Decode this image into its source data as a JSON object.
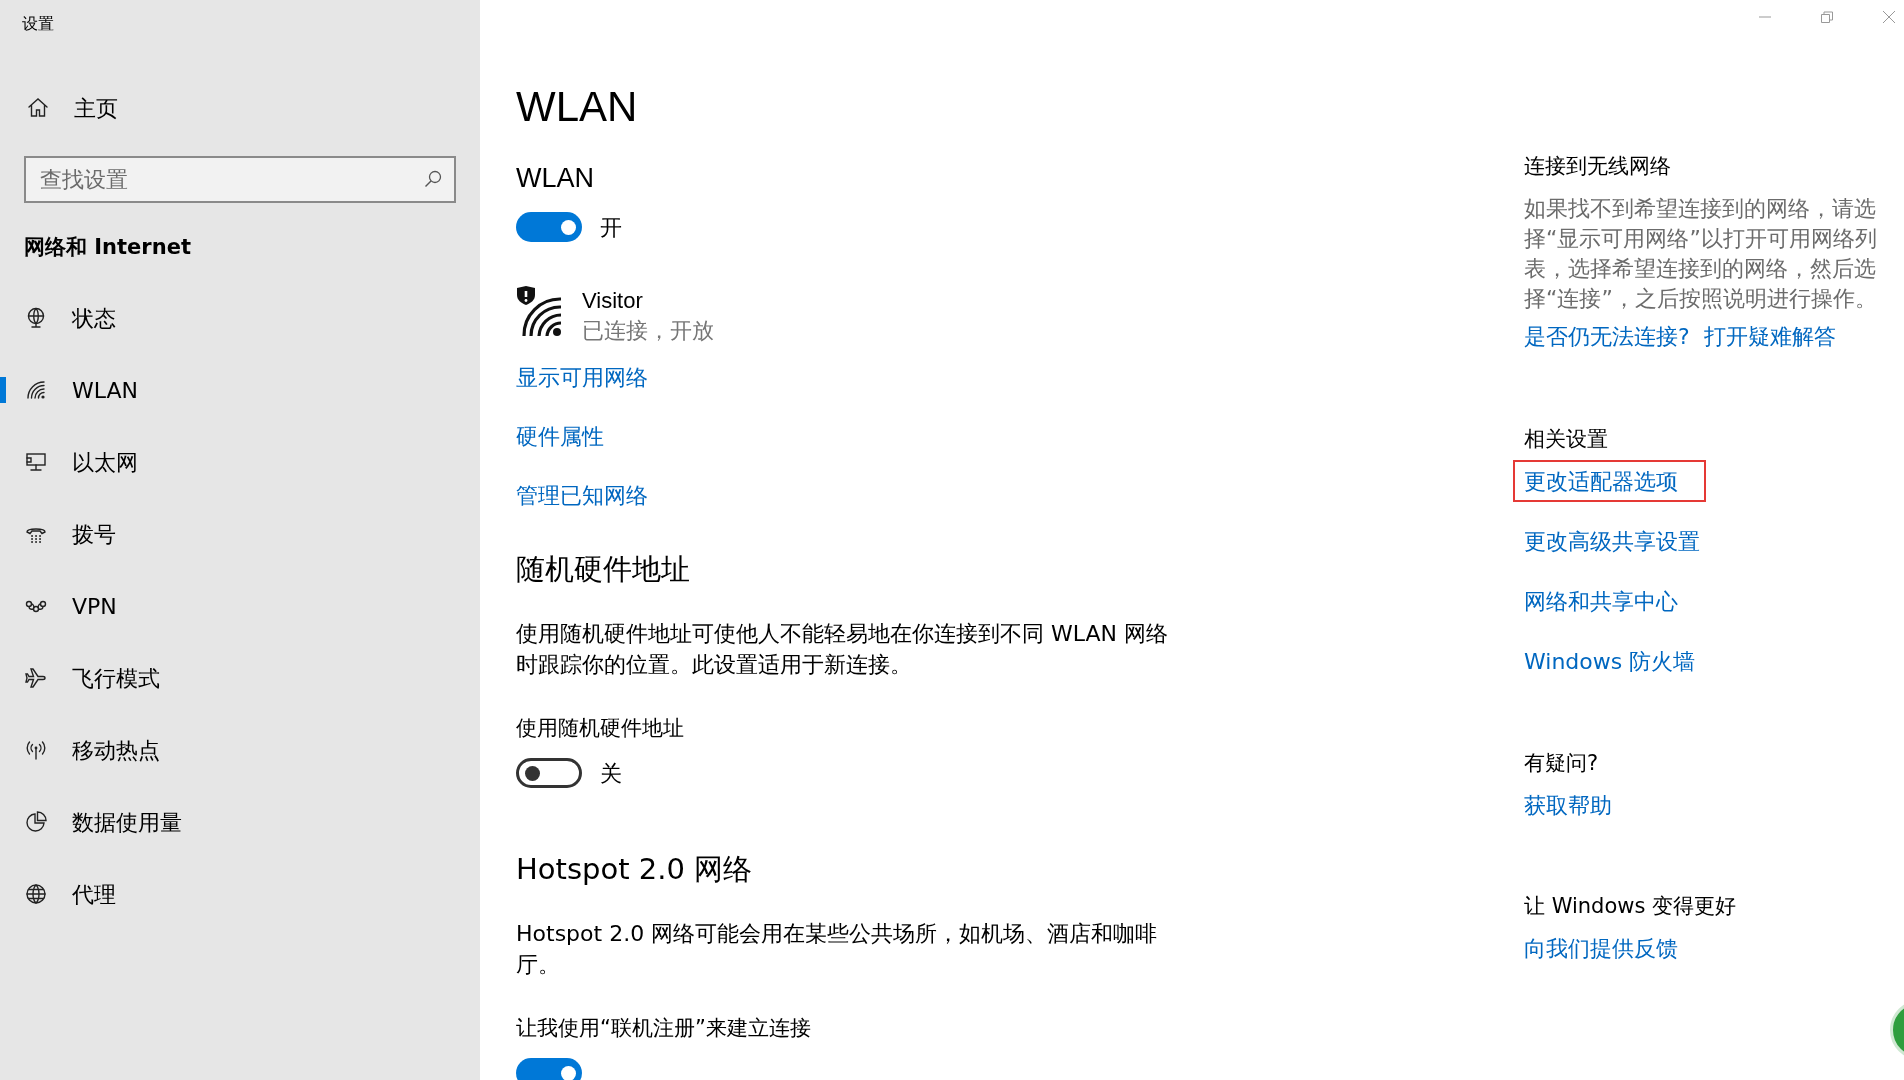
{
  "window": {
    "title": "设置"
  },
  "sidebar": {
    "home": "主页",
    "search": {
      "placeholder": "查找设置"
    },
    "section": "网络和 Internet",
    "items": [
      {
        "kind": "status",
        "label": "状态",
        "selected": false
      },
      {
        "kind": "wlan",
        "label": "WLAN",
        "selected": true
      },
      {
        "kind": "ethernet",
        "label": "以太网",
        "selected": false
      },
      {
        "kind": "dialup",
        "label": "拨号",
        "selected": false
      },
      {
        "kind": "vpn",
        "label": "VPN",
        "selected": false
      },
      {
        "kind": "airplane",
        "label": "飞行模式",
        "selected": false
      },
      {
        "kind": "hotspot",
        "label": "移动热点",
        "selected": false
      },
      {
        "kind": "data",
        "label": "数据使用量",
        "selected": false
      },
      {
        "kind": "proxy",
        "label": "代理",
        "selected": false
      }
    ]
  },
  "main": {
    "title": "WLAN",
    "wlan": {
      "label": "WLAN",
      "on": true,
      "state": "开"
    },
    "network": {
      "name": "Visitor",
      "status": "已连接，开放"
    },
    "links": [
      "显示可用网络",
      "硬件属性",
      "管理已知网络"
    ],
    "random_mac": {
      "heading": "随机硬件地址",
      "description": "使用随机硬件地址可使他人不能轻易地在你连接到不同 WLAN 网络时跟踪你的位置。此设置适用于新连接。",
      "label": "使用随机硬件地址",
      "on": false,
      "state": "关"
    },
    "hotspot": {
      "heading": "Hotspot 2.0 网络",
      "description": "Hotspot 2.0 网络可能会用在某些公共场所，如机场、酒店和咖啡厅。",
      "label": "让我使用“联机注册”来建立连接",
      "on": true
    }
  },
  "related": [
    {
      "kind": "inline",
      "heading": "连接到无线网络",
      "description": "如果找不到希望连接到的网络，请选择“显示可用网络”以打开可用网络列表，选择希望连接到的网络，然后选择“连接”，之后按照说明进行操作。",
      "links": [
        {
          "label": "是否仍无法连接?",
          "highlighted": false
        },
        {
          "label": "打开疑难解答",
          "highlighted": false
        }
      ]
    },
    {
      "kind": "list",
      "heading": "相关设置",
      "links": [
        {
          "label": "更改适配器选项",
          "highlighted": true
        },
        {
          "label": "更改高级共享设置",
          "highlighted": false
        },
        {
          "label": "网络和共享中心",
          "highlighted": false
        },
        {
          "label": "Windows 防火墙",
          "highlighted": false
        }
      ]
    },
    {
      "kind": "list",
      "heading": "有疑问?",
      "links": [
        {
          "label": "获取帮助",
          "highlighted": false
        }
      ]
    },
    {
      "kind": "list",
      "heading": "让 Windows 变得更好",
      "links": [
        {
          "label": "向我们提供反馈",
          "highlighted": false
        }
      ]
    }
  ]
}
